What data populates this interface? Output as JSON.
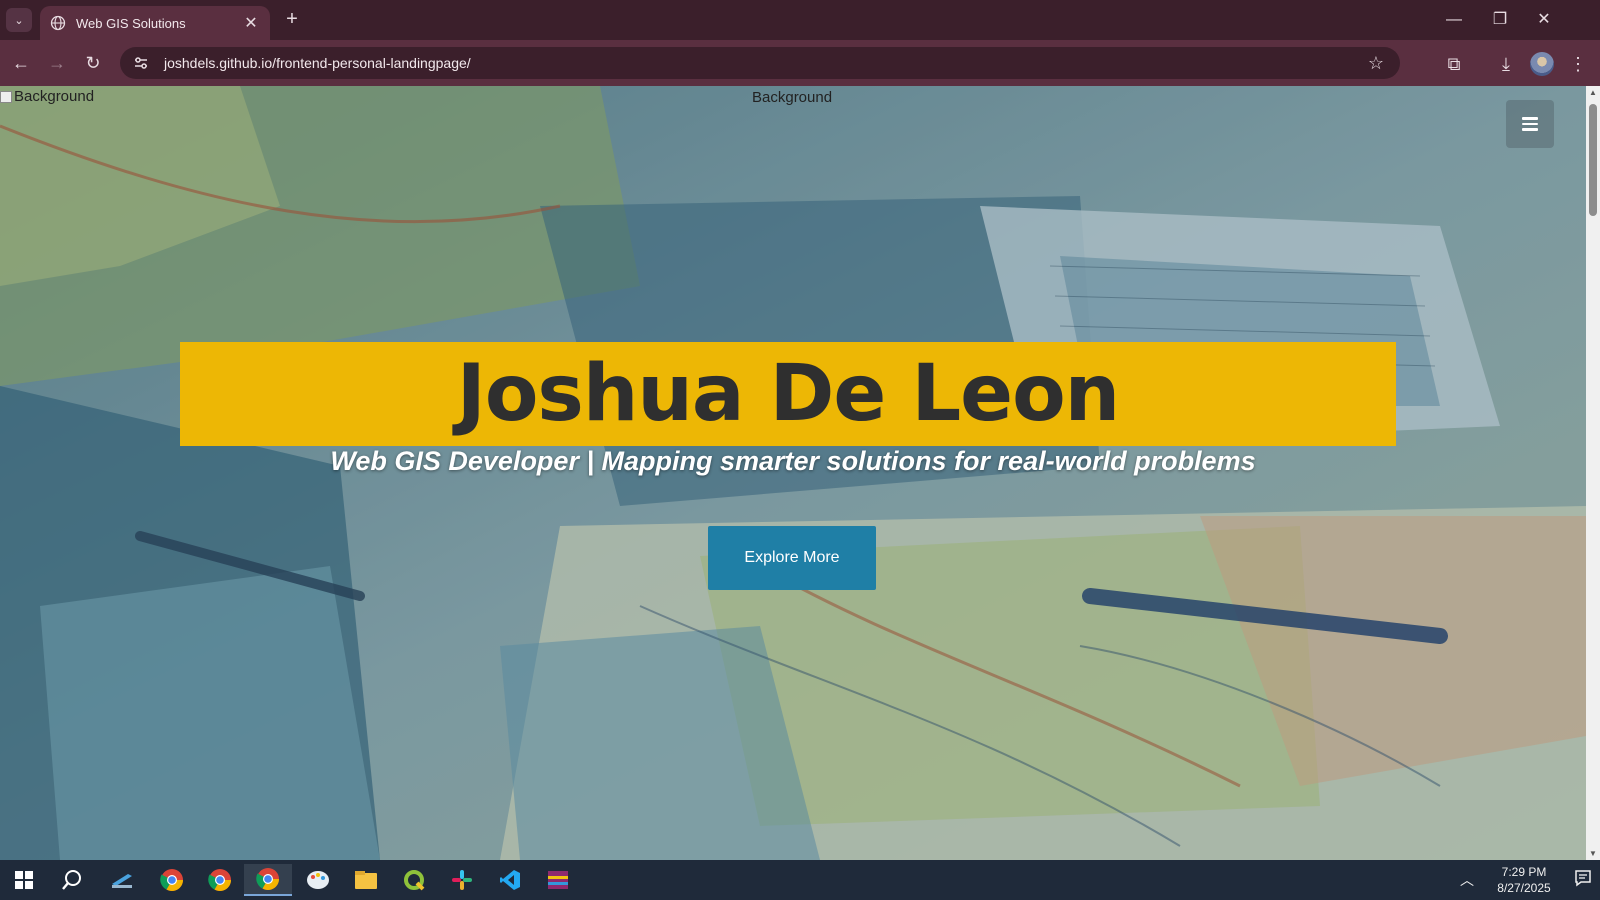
{
  "browser": {
    "tab_title": "Web GIS Solutions",
    "url": "joshdels.github.io/frontend-personal-landingpage/",
    "new_tab_label": "+",
    "close_tab_label": "✕"
  },
  "page": {
    "broken_bg_alt_left": "Background",
    "broken_bg_alt_center": "Background",
    "hero_name": "Joshua De Leon",
    "hero_subtitle": "Web GIS Developer | Mapping smarter solutions for real-world problems",
    "cta_label": "Explore More",
    "colors": {
      "name_banner": "#edb705",
      "cta_button": "#1f7fa6"
    }
  },
  "taskbar": {
    "time": "7:29 PM",
    "date": "8/27/2025",
    "apps": [
      "windows-start-icon",
      "search-icon",
      "terminal-icon",
      "chrome-icon",
      "chrome-profile-icon",
      "chrome-active-icon",
      "paint-icon",
      "file-explorer-icon",
      "qgis-icon",
      "slack-icon",
      "vscode-icon",
      "winrar-icon"
    ]
  }
}
